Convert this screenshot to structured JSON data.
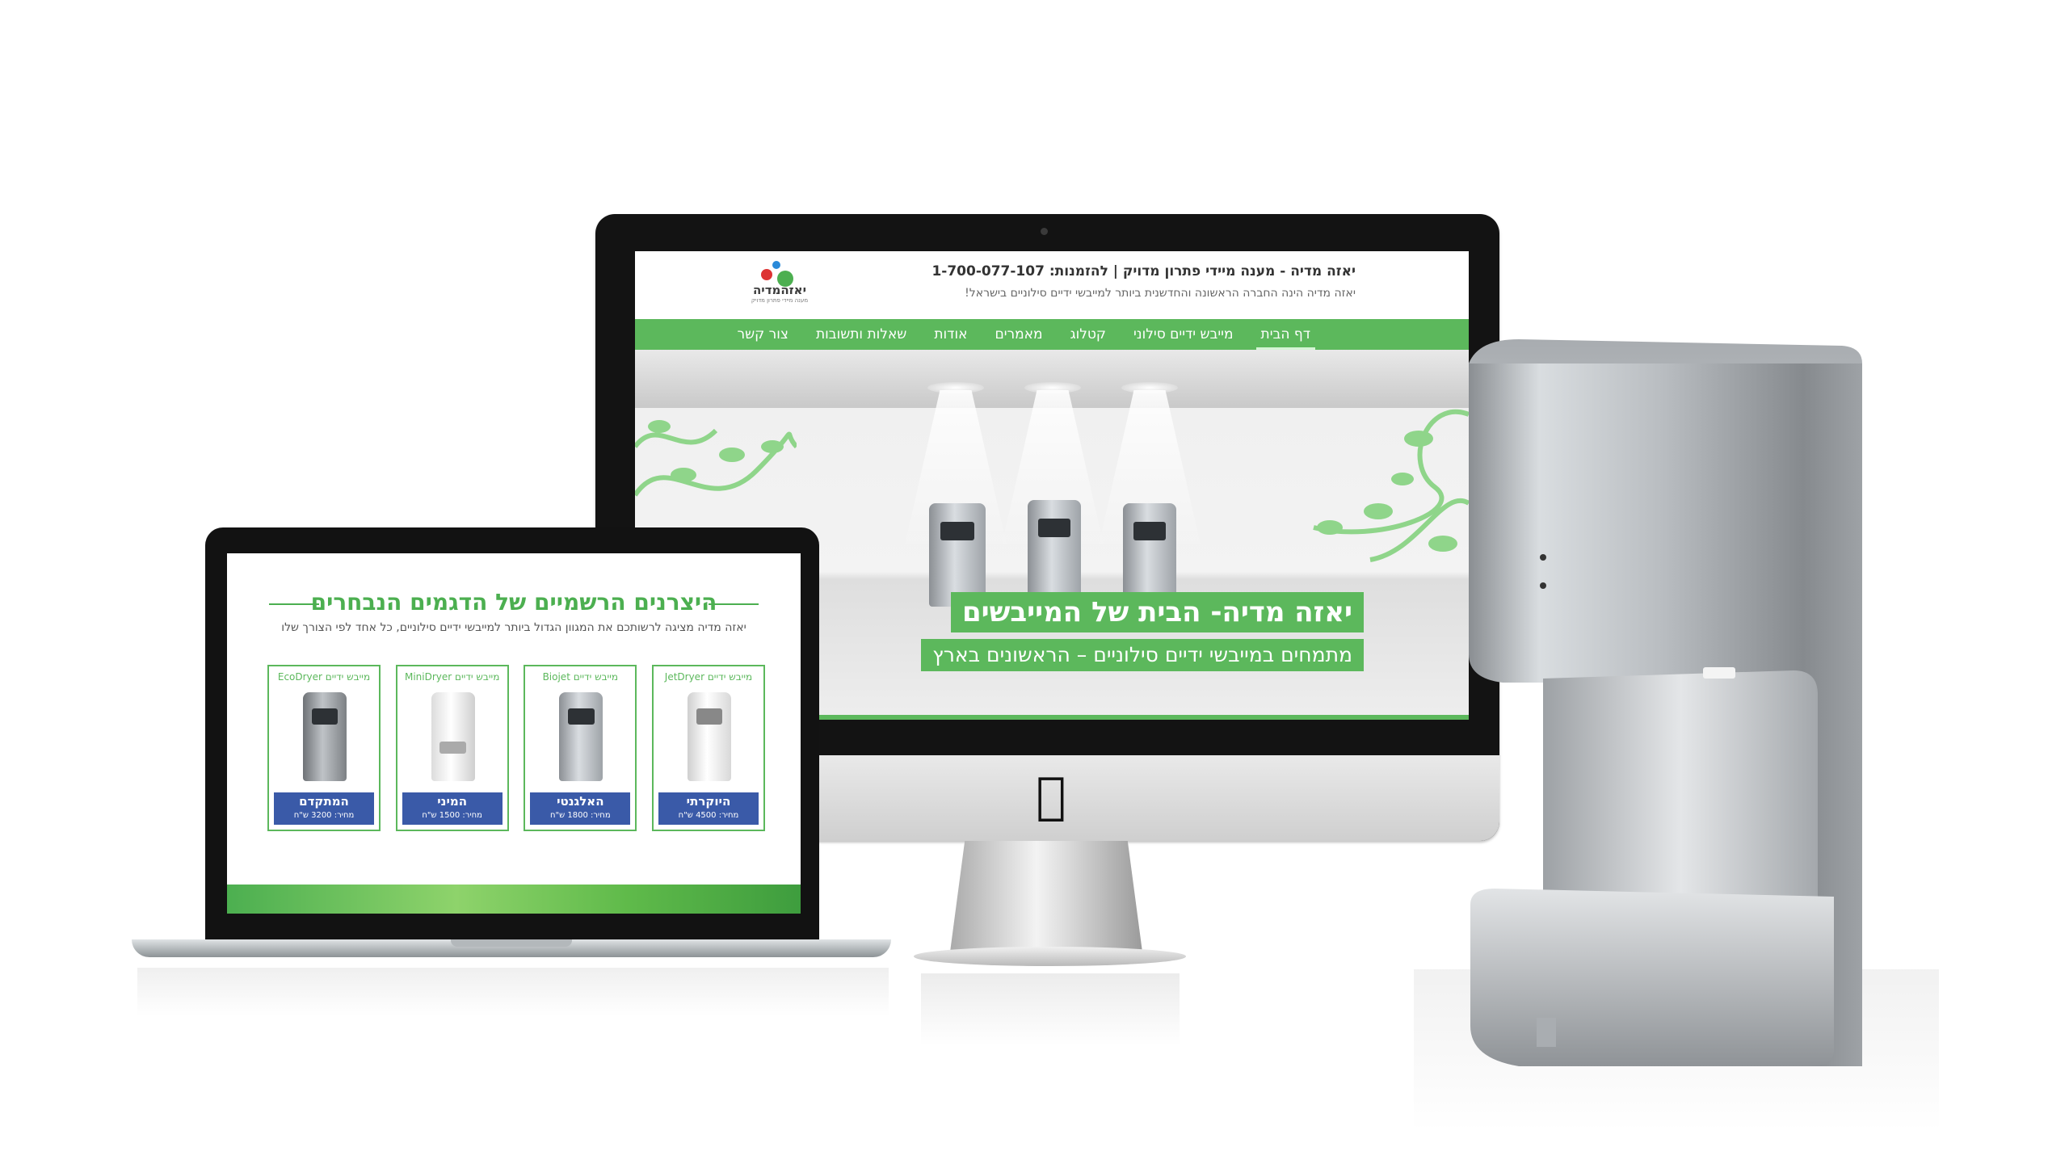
{
  "site": {
    "title": "יאזה מדיה - מענה מיידי פתרון מדויק | להזמנות: 1-700-077-107",
    "subtitle": "יאזה מדיה הינה החברה הראשונה והחדשנית ביותר למייבשי ידיים סילוניים בישראל!",
    "logo_text": "יאזהמדיה",
    "logo_tagline": "מענה מיידי פתרון מדויק",
    "nav": [
      {
        "label": "דף הבית",
        "active": true
      },
      {
        "label": "מייבש ידיים סילוני",
        "active": false
      },
      {
        "label": "קטלוג",
        "active": false
      },
      {
        "label": "מאמרים",
        "active": false
      },
      {
        "label": "אודות",
        "active": false
      },
      {
        "label": "שאלות ותשובות",
        "active": false
      },
      {
        "label": "צור קשר",
        "active": false
      }
    ],
    "hero_heading": "יאזה מדיה- הבית של המייבשים",
    "hero_subheading": "מתמחים במייבשי ידיים סילוניים – הראשונים בארץ"
  },
  "laptop": {
    "title": "היצרנים הרשמיים של הדגמים הנבחרים",
    "subtitle": "יאזה מדיה מציגה לרשותכם את המגוון הגדול ביותר למייבשי ידיים סילוניים, כל אחד לפי הצורך שלו",
    "cards": [
      {
        "name": "מייבש ידיים JetDryer",
        "label": "היוקרתי",
        "price": "מחיר: 4500 ש\"ח"
      },
      {
        "name": "מייבש ידיים Biojet",
        "label": "האלגנטי",
        "price": "מחיר: 1800 ש\"ח"
      },
      {
        "name": "מייבש ידיים MiniDryer",
        "label": "המיני",
        "price": "מחיר: 1500 ש\"ח"
      },
      {
        "name": "מייבש ידיים EcoDryer",
        "label": "המתקדם",
        "price": "מחיר: 3200 ש\"ח"
      }
    ]
  },
  "colors": {
    "brand_green": "#5cb85c",
    "price_blue": "#3a5aa8"
  },
  "icons": {
    "device_logo": "apple-icon"
  }
}
